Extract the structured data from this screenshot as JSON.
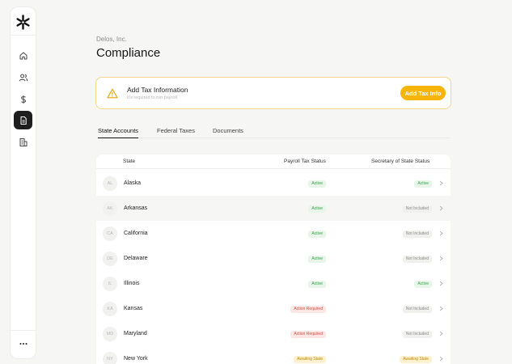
{
  "company": "Delos, Inc.",
  "title": "Compliance",
  "alert": {
    "title": "Add Tax Information",
    "subtitle": "It's required to run payroll",
    "button": "Add Tax Info"
  },
  "tabs": [
    "State Accounts",
    "Federal Taxes",
    "Documents"
  ],
  "table": {
    "headers": {
      "state": "State",
      "payroll": "Payroll Tax Status",
      "sos": "Secretary of State Status"
    },
    "rows": [
      {
        "abbr": "AL",
        "name": "Alaska",
        "payroll": "Active",
        "sos": "Active"
      },
      {
        "abbr": "AK",
        "name": "Arkansas",
        "payroll": "Active",
        "sos": "Not Included"
      },
      {
        "abbr": "CA",
        "name": "California",
        "payroll": "Active",
        "sos": "Not Included"
      },
      {
        "abbr": "DE",
        "name": "Delaware",
        "payroll": "Active",
        "sos": "Not Included"
      },
      {
        "abbr": "IL",
        "name": "Illinois",
        "payroll": "Active",
        "sos": "Active"
      },
      {
        "abbr": "KA",
        "name": "Kansas",
        "payroll": "Action Required",
        "sos": "Not Included"
      },
      {
        "abbr": "MD",
        "name": "Maryland",
        "payroll": "Action Required",
        "sos": "Not Included"
      },
      {
        "abbr": "NY",
        "name": "New York",
        "payroll": "Awaiting State",
        "sos": "Awaiting State"
      }
    ]
  },
  "sidebar": {
    "items": [
      "home-icon",
      "people-icon",
      "dollar-icon",
      "document-icon",
      "building-icon"
    ],
    "more": "···"
  },
  "colors": {
    "accent": "#f5b50a",
    "alert_border": "#f3d58c",
    "active_nav": "#1e1e1e"
  }
}
